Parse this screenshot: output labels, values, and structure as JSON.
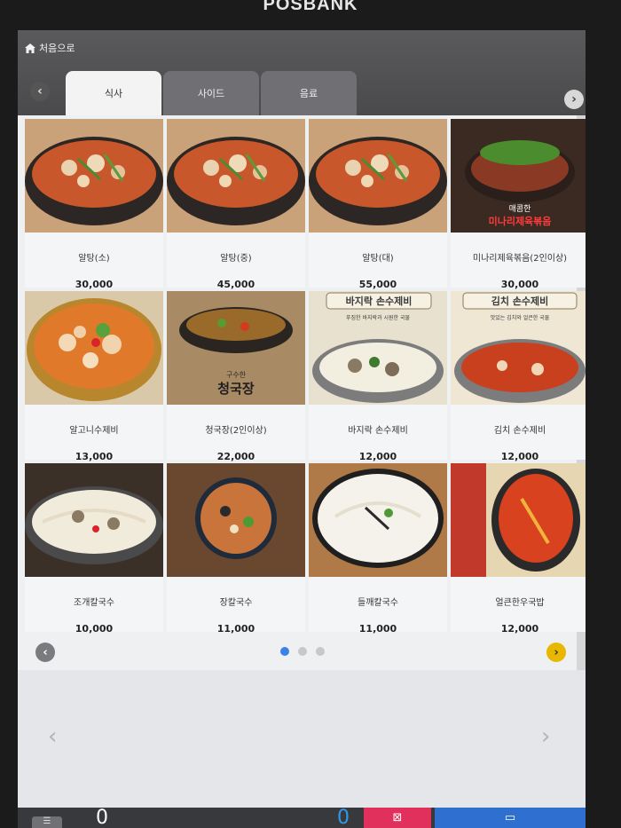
{
  "brand": "POSBANK",
  "header": {
    "home_label": "처음으로"
  },
  "tabs": [
    {
      "label": "식사",
      "active": true
    },
    {
      "label": "사이드",
      "active": false
    },
    {
      "label": "음료",
      "active": false
    }
  ],
  "menu_items": [
    {
      "name": "알탕(소)",
      "price": "30,000",
      "image": "spicy-pollack-roe-stew"
    },
    {
      "name": "알탕(중)",
      "price": "45,000",
      "image": "spicy-pollack-roe-stew"
    },
    {
      "name": "알탕(대)",
      "price": "55,000",
      "image": "spicy-pollack-roe-stew"
    },
    {
      "name": "미나리제육볶음(2인이상)",
      "price": "30,000",
      "image": "pork-with-water-parsley",
      "caption_line1": "매콤한",
      "caption_line2": "미나리제육볶음"
    },
    {
      "name": "알고니수제비",
      "price": "13,000",
      "image": "roe-sujebi-pot"
    },
    {
      "name": "청국장(2인이상)",
      "price": "22,000",
      "image": "cheonggukjang-stew",
      "caption_line1": "구수한",
      "caption_line2": "청국장"
    },
    {
      "name": "바지락 손수제비",
      "price": "12,000",
      "image": "clam-sujebi",
      "caption_line1": "바지락 손수제비",
      "caption_line2": "푸짐한 바지락과 시원한 국물"
    },
    {
      "name": "김치 손수제비",
      "price": "12,000",
      "image": "kimchi-sujebi",
      "caption_line1": "김치 손수제비",
      "caption_line2": "맛있는 김치와 얼큰한 국물"
    },
    {
      "name": "조개칼국수",
      "price": "10,000",
      "image": "clam-kalguksu"
    },
    {
      "name": "장칼국수",
      "price": "11,000",
      "image": "jang-kalguksu"
    },
    {
      "name": "들깨칼국수",
      "price": "11,000",
      "image": "perilla-kalguksu"
    },
    {
      "name": "얼큰한우국밥",
      "price": "12,000",
      "image": "spicy-beef-gukbap"
    }
  ],
  "pagination": {
    "pages": 3,
    "current": 1
  },
  "footer": {
    "item_count": "0",
    "total_count": "0",
    "menu_label": "☰"
  },
  "colors": {
    "accent_blue": "#2f6fd0",
    "clear_red": "#e0305b",
    "next_yellow": "#e8b800"
  }
}
